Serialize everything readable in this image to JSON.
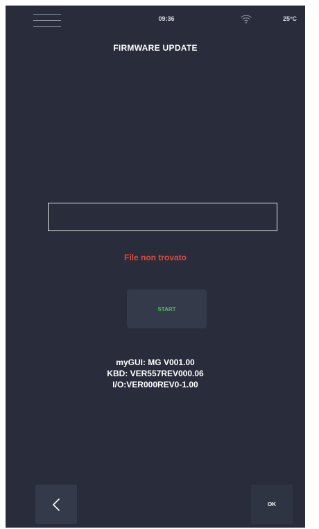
{
  "status_bar": {
    "time": "09:36",
    "temperature": "25°C",
    "menu_icon": "hamburger-menu-icon",
    "wifi_icon": "wifi-icon"
  },
  "header": {
    "title": "FIRMWARE UPDATE"
  },
  "file_field": {
    "value": ""
  },
  "error": {
    "message": "File non trovato"
  },
  "start_button": {
    "label": "START"
  },
  "versions": {
    "lines": [
      "myGUI: MG V001.00",
      "KBD: VER557REV000.06",
      "I/O:VER000REV0-1.00"
    ]
  },
  "footer": {
    "back_icon": "chevron-left-icon",
    "ok_label": "OK"
  },
  "colors": {
    "background": "#282c3b",
    "button_background": "#353a4a",
    "error": "#e24a3c",
    "start_label": "#47c255",
    "text": "#ffffff"
  }
}
